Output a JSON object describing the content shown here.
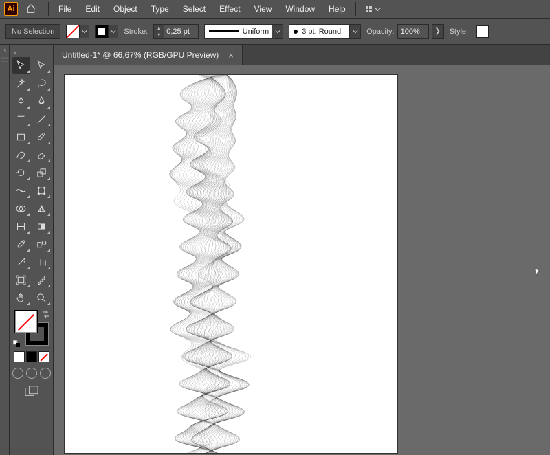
{
  "app": {
    "logo_text": "Ai"
  },
  "menu": {
    "items": [
      "File",
      "Edit",
      "Object",
      "Type",
      "Select",
      "Effect",
      "View",
      "Window",
      "Help"
    ]
  },
  "control": {
    "selection_label": "No Selection",
    "stroke_label": "Stroke:",
    "stroke_value": "0,25 pt",
    "profile_label": "Uniform",
    "brush_label": "3 pt. Round",
    "opacity_label": "Opacity:",
    "opacity_value": "100%",
    "style_label": "Style:"
  },
  "tab": {
    "title": "Untitled-1* @ 66,67% (RGB/GPU Preview)"
  },
  "tools": {
    "rows": [
      [
        "selection",
        "direct-selection"
      ],
      [
        "magic-wand",
        "lasso"
      ],
      [
        "pen",
        "curvature"
      ],
      [
        "type",
        "line-segment"
      ],
      [
        "rectangle",
        "paintbrush"
      ],
      [
        "shaper",
        "eraser"
      ],
      [
        "rotate",
        "scale"
      ],
      [
        "width",
        "free-transform"
      ],
      [
        "shape-builder",
        "perspective-grid"
      ],
      [
        "mesh",
        "gradient"
      ],
      [
        "eyedropper",
        "blend"
      ],
      [
        "symbol-sprayer",
        "column-graph"
      ],
      [
        "artboard",
        "slice"
      ],
      [
        "hand",
        "zoom"
      ]
    ]
  }
}
